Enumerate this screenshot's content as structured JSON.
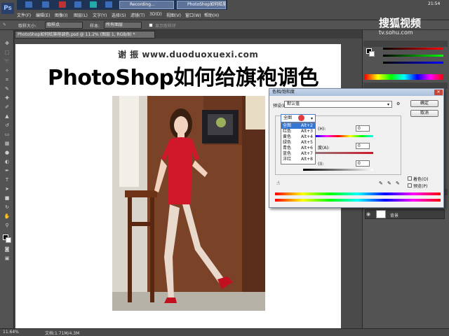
{
  "app": {
    "logo": "Ps",
    "menu": [
      "文件(F)",
      "编辑(E)",
      "图像(I)",
      "图层(L)",
      "文字(Y)",
      "选择(S)",
      "滤镜(T)",
      "3D(D)",
      "视图(V)",
      "窗口(W)",
      "帮助(H)"
    ],
    "taskbar": [
      "Recording...",
      "PhotoShop如何给旗..."
    ],
    "clock": "21:54"
  },
  "options_bar": {
    "sample_size_label": "取样大小:",
    "sample_size_value": "取样点",
    "sample_label": "样本:",
    "sample_value": "所有图层",
    "show_ring_label": "显示取样环"
  },
  "document": {
    "tab_title": "PhotoShop如何给旗袍调色.psd @ 11.2% (图层 1, RGB/8) *",
    "watermark": "谢 振  www.duoduoxuexi.com",
    "title": "PhotoShop如何给旗袍调色"
  },
  "status_bar": {
    "zoom": "11.64%",
    "doc_info": "文档:1.71M/4.3M"
  },
  "branding": {
    "logo": "搜狐视频",
    "url": "tv.sohu.com"
  },
  "right_panels": {
    "layer_name": "背景"
  },
  "dialog": {
    "title": "色相/饱和度",
    "preset_label": "预设(E):",
    "preset_value": "默认值",
    "ok": "确定",
    "cancel": "取消",
    "edit_value": "全图",
    "channels": [
      {
        "name": "全图",
        "key": "Alt+2",
        "selected": true
      },
      {
        "name": "红色",
        "key": "Alt+3",
        "selected": false
      },
      {
        "name": "黄色",
        "key": "Alt+4",
        "selected": false
      },
      {
        "name": "绿色",
        "key": "Alt+5",
        "selected": false
      },
      {
        "name": "青色",
        "key": "Alt+6",
        "selected": false
      },
      {
        "name": "蓝色",
        "key": "Alt+7",
        "selected": false
      },
      {
        "name": "洋红",
        "key": "Alt+8",
        "selected": false
      }
    ],
    "hue_label": "(H):",
    "hue_value": "0",
    "saturation_label": "度(A):",
    "saturation_value": "0",
    "lightness_label": "(I):",
    "lightness_value": "0",
    "colorize_label": "着色(O)",
    "preview_label": "预览(P)",
    "colorize_checked": false,
    "preview_checked": true
  }
}
